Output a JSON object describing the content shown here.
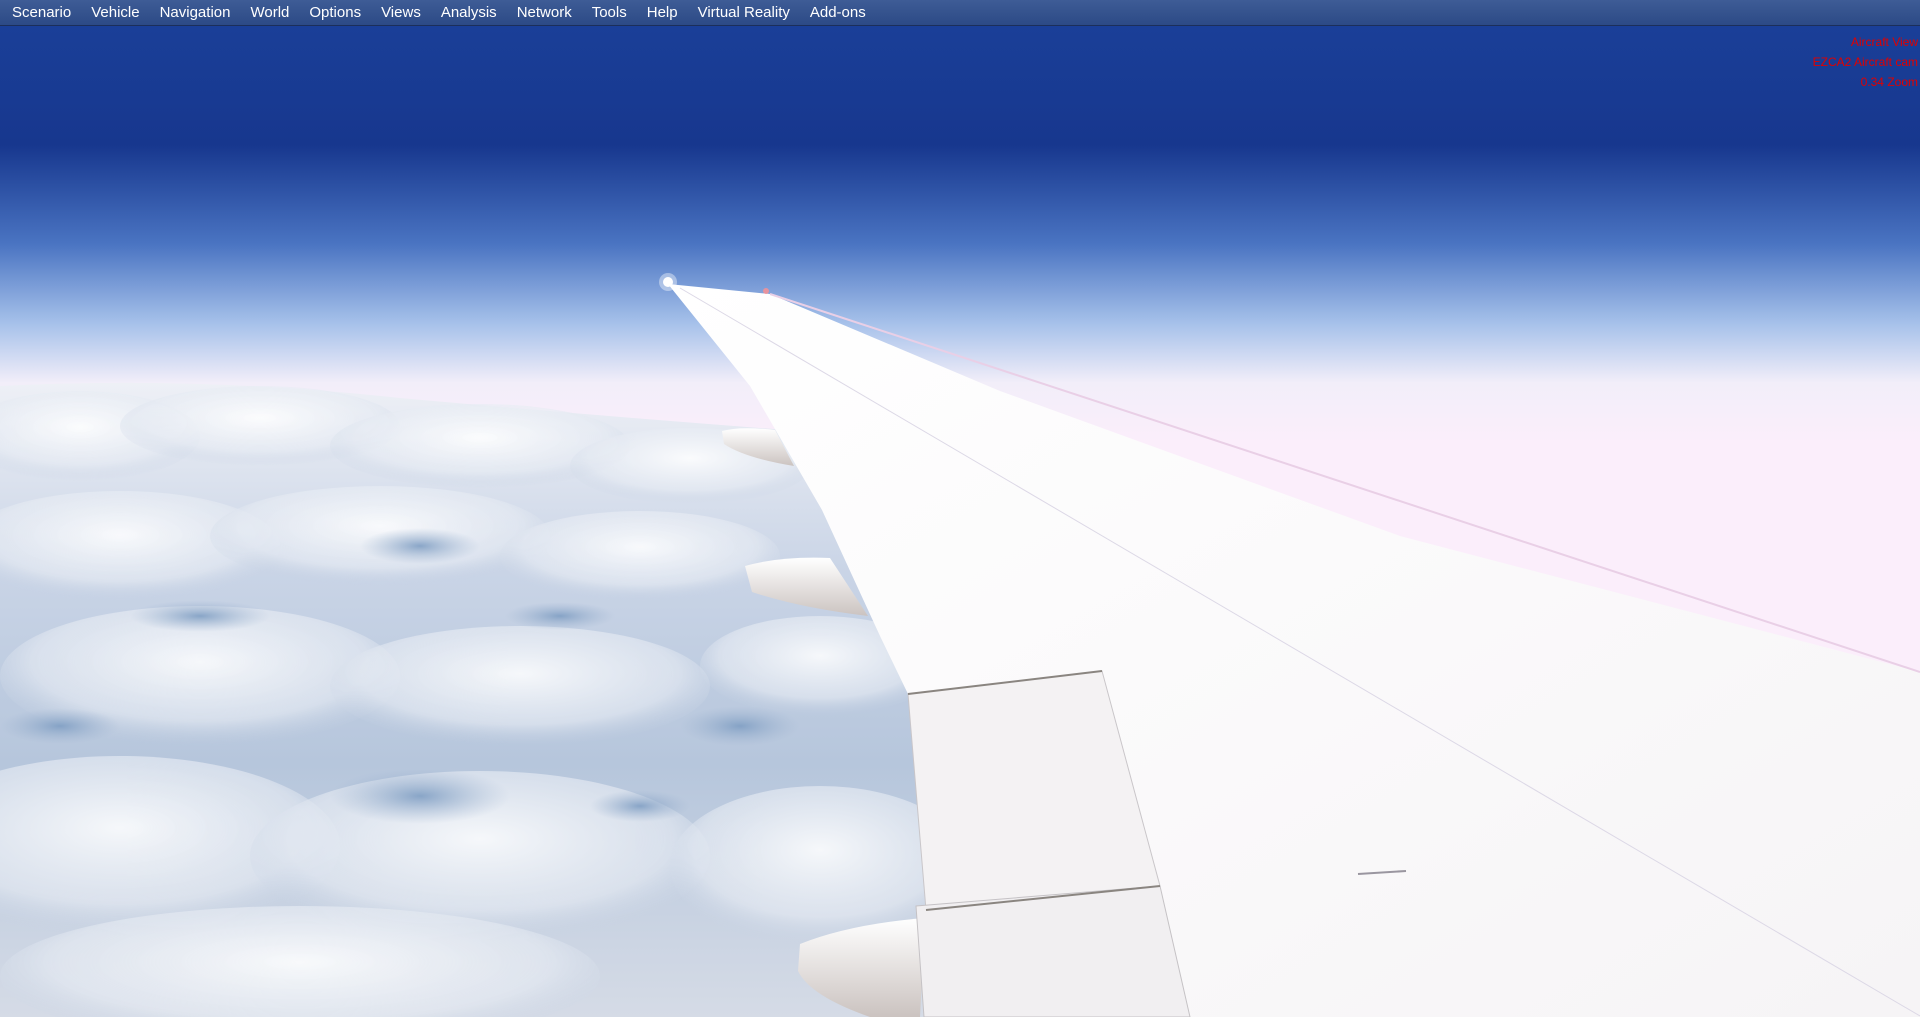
{
  "menu": {
    "items": [
      {
        "id": "scenario",
        "label": "Scenario"
      },
      {
        "id": "vehicle",
        "label": "Vehicle"
      },
      {
        "id": "navigation",
        "label": "Navigation"
      },
      {
        "id": "world",
        "label": "World"
      },
      {
        "id": "options",
        "label": "Options"
      },
      {
        "id": "views",
        "label": "Views"
      },
      {
        "id": "analysis",
        "label": "Analysis"
      },
      {
        "id": "network",
        "label": "Network"
      },
      {
        "id": "tools",
        "label": "Tools"
      },
      {
        "id": "help",
        "label": "Help"
      },
      {
        "id": "virtual-reality",
        "label": "Virtual Reality"
      },
      {
        "id": "add-ons",
        "label": "Add-ons"
      }
    ]
  },
  "overlay": {
    "view_name": "Aircraft View",
    "camera_name": "EZCA2 Aircraft cam",
    "zoom": "0.34 Zoom"
  },
  "colors": {
    "menubar": "#34528e",
    "sky_top": "#17388f",
    "horizon": "#fbeefb",
    "overlay_text": "#e00000"
  }
}
